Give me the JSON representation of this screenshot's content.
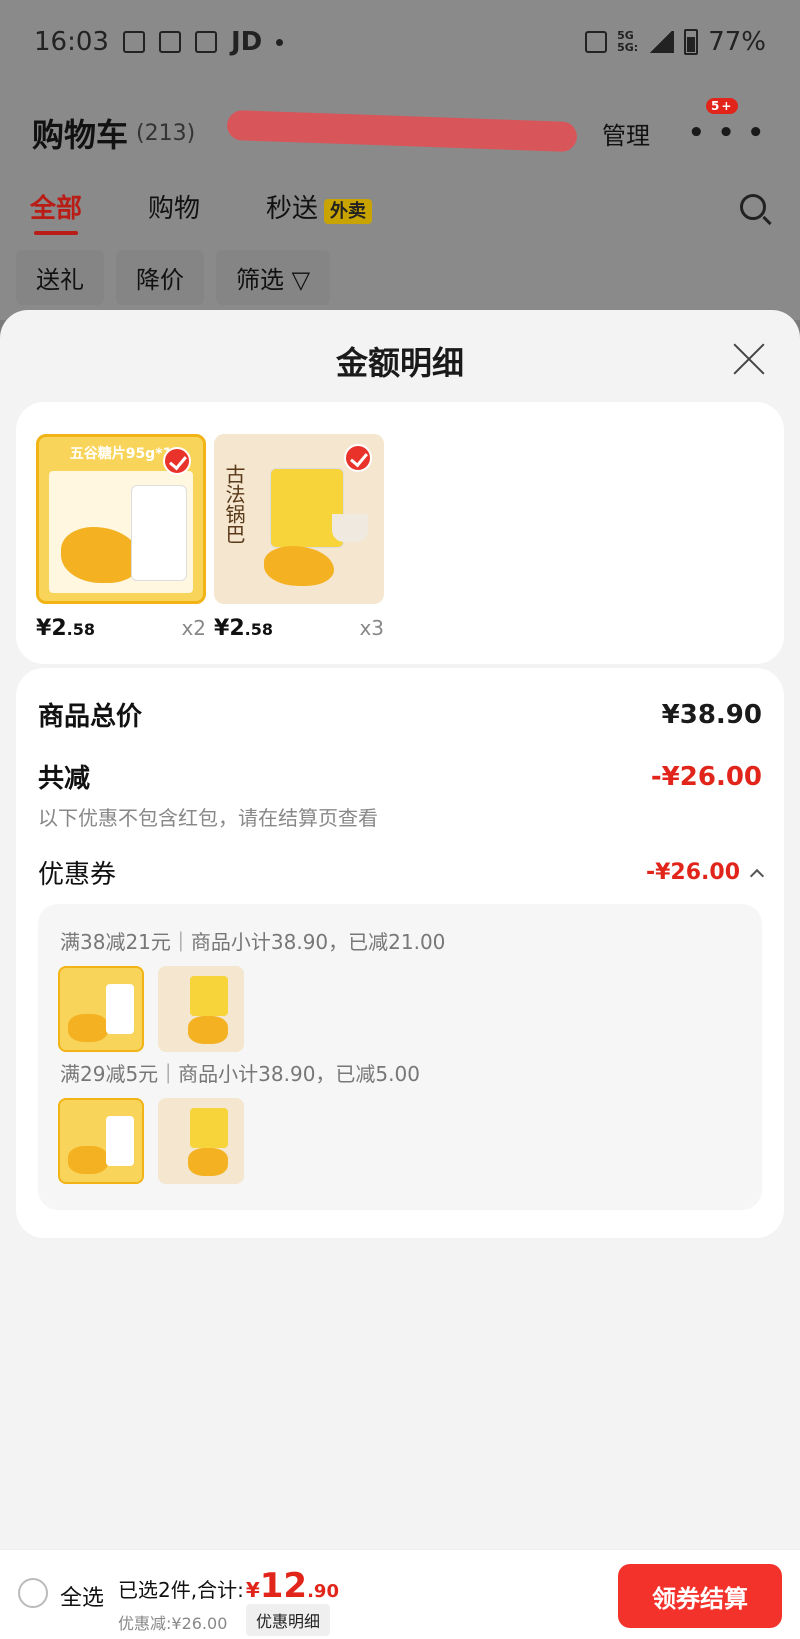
{
  "status_bar": {
    "time": "16:03",
    "carrier_label": "JD",
    "net_top": "5G",
    "net_bottom": "5G:",
    "battery": "77%"
  },
  "header": {
    "title": "购物车",
    "count": "(213)",
    "manage": "管理",
    "more_badge": "5+"
  },
  "tabs": [
    {
      "label": "全部",
      "active": true
    },
    {
      "label": "购物"
    },
    {
      "label": "秒送",
      "badge": "外卖"
    }
  ],
  "filters": [
    "送礼",
    "降价",
    "筛选"
  ],
  "sheet": {
    "title": "金额明细",
    "products": [
      {
        "header": "五谷糖片95g*1",
        "currency": "¥",
        "int": "2",
        "dec": ".58",
        "qty": "x2"
      },
      {
        "vertical_text": "古法锅巴",
        "currency": "¥",
        "int": "2",
        "dec": ".58",
        "qty": "x3"
      }
    ],
    "summary": {
      "total_label": "商品总价",
      "total_value": "¥38.90",
      "reduce_label": "共减",
      "reduce_value": "-¥26.00",
      "note": "以下优惠不包含红包，请在结算页查看",
      "coupon_label": "优惠券",
      "coupon_value": "-¥26.00",
      "coupons": [
        {
          "text": "满38减21元｜商品小计38.90，已减21.00"
        },
        {
          "text": "满29减5元｜商品小计38.90，已减5.00"
        }
      ]
    }
  },
  "bottom_bar": {
    "select_all": "全选",
    "selected_text": "已选2件,合计:",
    "total_currency": "¥",
    "total_int": "12",
    "total_dec": ".90",
    "discount_text": "优惠减:¥26.00",
    "detail_button": "优惠明细",
    "checkout": "领券结算"
  },
  "colors": {
    "accent_red": "#e1251b",
    "checkout_red": "#f4322c"
  }
}
